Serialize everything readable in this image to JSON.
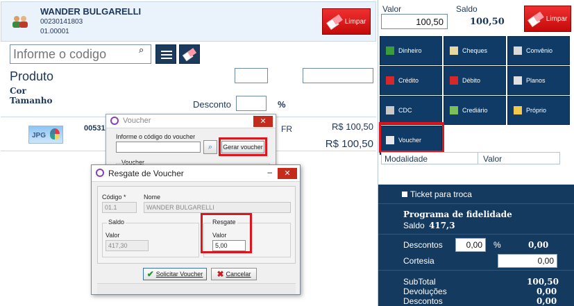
{
  "customer": {
    "name": "WANDER BULGARELLI",
    "document": "00230141803",
    "code": "01.00001",
    "clear_label": "Limpar"
  },
  "search": {
    "placeholder": "Informe o codigo"
  },
  "product": {
    "title": "Produto",
    "color_label": "Cor",
    "size_label": "Tamanho",
    "discount_label": "Desconto",
    "discount_unit": "%"
  },
  "item": {
    "image_label": "JPG",
    "code": "00531",
    "fragment": "FR",
    "price": "R$ 100,50",
    "total": "R$ 100,50"
  },
  "voucher_dialog": {
    "title": "Voucher",
    "code_label": "Informe o código do voucher",
    "generate_label": "Gerar voucher",
    "group_label": "Voucher"
  },
  "resgate_dialog": {
    "title": "Resgate de Voucher",
    "code_label": "Código *",
    "code_value": "01.1",
    "name_label": "Nome",
    "name_value": "WANDER BULGARELLI",
    "saldo_group": "Saldo",
    "saldo_valor_label": "Valor",
    "saldo_valor": "417,30",
    "resgate_group": "Resgate",
    "resgate_valor_label": "Valor",
    "resgate_valor": "5,00",
    "request_label": "Solicitar Voucher",
    "cancel_label": "Cancelar"
  },
  "payment": {
    "valor_label": "Valor",
    "valor": "100,50",
    "saldo_label": "Saldo",
    "saldo": "100,50",
    "clear_label": "Limpar",
    "methods": [
      {
        "label": "Dinheiro",
        "icon": "cash-icon"
      },
      {
        "label": "Cheques",
        "icon": "checks-icon"
      },
      {
        "label": "Convênio",
        "icon": "agreement-icon"
      },
      {
        "label": "Crédito",
        "icon": "credit-icon"
      },
      {
        "label": "Débito",
        "icon": "debit-icon"
      },
      {
        "label": "Planos",
        "icon": "plans-icon"
      },
      {
        "label": "CDC",
        "icon": "cdc-icon"
      },
      {
        "label": "Crediário",
        "icon": "installment-icon"
      },
      {
        "label": "Próprio",
        "icon": "own-icon"
      },
      {
        "label": "Voucher",
        "icon": "voucher-icon"
      }
    ],
    "modalidade_header": "Modalidade",
    "valor_header": "Valor"
  },
  "summary": {
    "ticket_label": "Ticket para troca",
    "loyalty_title": "Programa de fidelidade",
    "loyalty_saldo_label": "Saldo",
    "loyalty_saldo": "417,3",
    "descontos_label": "Descontos",
    "descontos_pct": "0,00",
    "descontos_unit": "%",
    "descontos_value": "0,00",
    "cortesia_label": "Cortesia",
    "cortesia_value": "0,00",
    "subtotal_label": "SubTotal",
    "subtotal_value": "100,50",
    "devolucoes_label": "Devoluções",
    "devolucoes_value": "0,00",
    "descontos2_label": "Descontos",
    "descontos2_value": "0,00"
  },
  "colors": {
    "accent_navy": "#0f3b66",
    "highlight_red": "#e0141a",
    "clear_red": "#d61616"
  }
}
